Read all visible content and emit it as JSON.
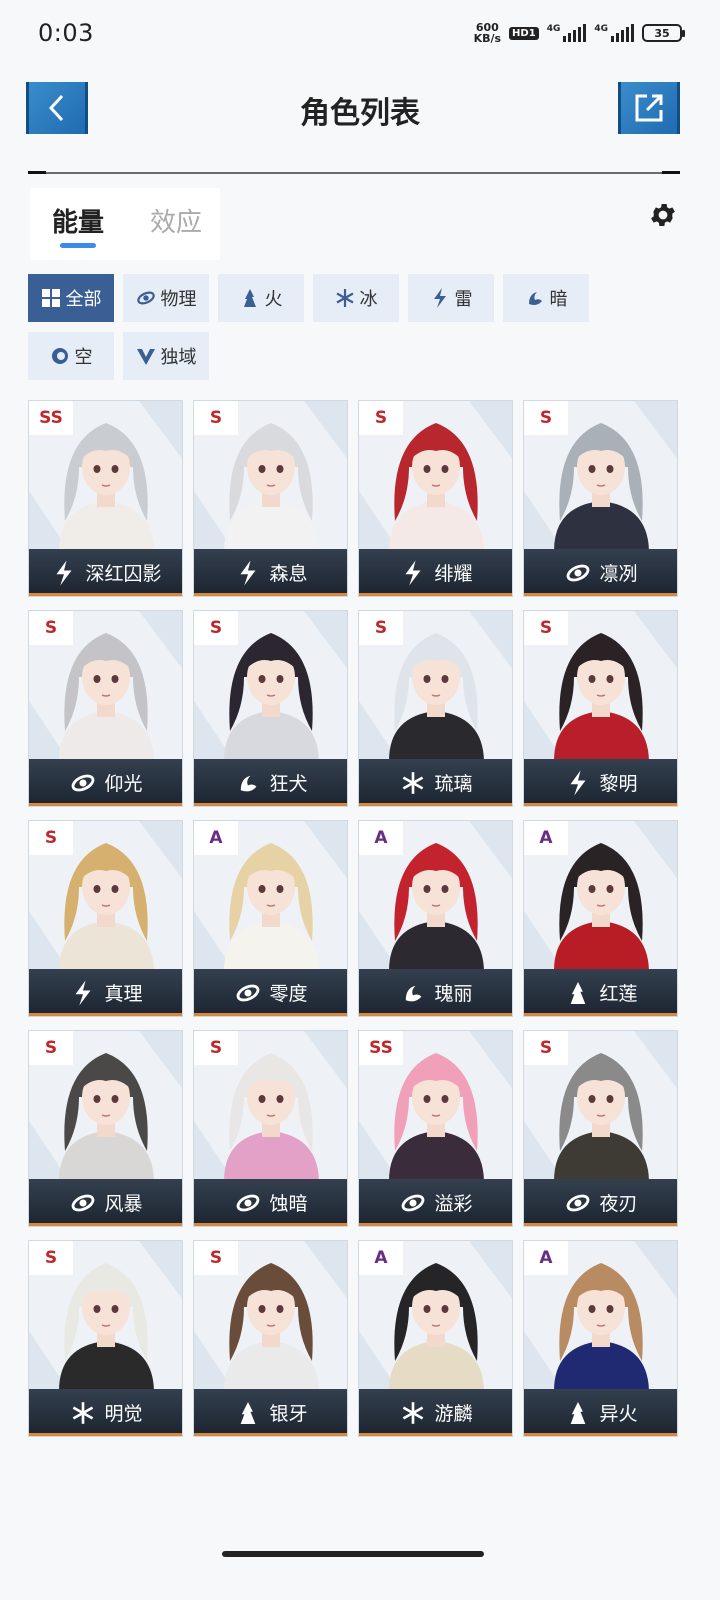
{
  "status_bar": {
    "time": "0:03",
    "net_speed_value": "600",
    "net_speed_unit": "KB/s",
    "hd_label": "HD1",
    "signal1_label": "4G",
    "signal2_label": "4G",
    "battery": "35"
  },
  "header": {
    "title": "角色列表",
    "back_icon": "chevron-left-icon",
    "share_icon": "external-link-icon",
    "button_color": "#2a7ac0"
  },
  "tabs": [
    {
      "label": "能量",
      "active": true
    },
    {
      "label": "效应",
      "active": false
    }
  ],
  "settings_icon": "gear-icon",
  "filters": [
    {
      "label": "全部",
      "icon": "grid-icon",
      "active": true
    },
    {
      "label": "物理",
      "icon": "physical-icon",
      "active": false
    },
    {
      "label": "火",
      "icon": "fire-icon",
      "active": false
    },
    {
      "label": "冰",
      "icon": "snowflake-icon",
      "active": false
    },
    {
      "label": "雷",
      "icon": "lightning-icon",
      "active": false
    },
    {
      "label": "暗",
      "icon": "dark-icon",
      "active": false
    },
    {
      "label": "空",
      "icon": "void-icon",
      "active": false
    },
    {
      "label": "独域",
      "icon": "domain-icon",
      "active": false
    }
  ],
  "characters": [
    {
      "rank": "SS",
      "name": "深红囚影",
      "element": "lightning-icon"
    },
    {
      "rank": "S",
      "name": "森息",
      "element": "lightning-icon"
    },
    {
      "rank": "S",
      "name": "绯耀",
      "element": "lightning-icon"
    },
    {
      "rank": "S",
      "name": "凛冽",
      "element": "physical-icon"
    },
    {
      "rank": "S",
      "name": "仰光",
      "element": "physical-icon"
    },
    {
      "rank": "S",
      "name": "狂犬",
      "element": "dark-icon"
    },
    {
      "rank": "S",
      "name": "琉璃",
      "element": "snowflake-icon"
    },
    {
      "rank": "S",
      "name": "黎明",
      "element": "lightning-icon"
    },
    {
      "rank": "S",
      "name": "真理",
      "element": "lightning-icon"
    },
    {
      "rank": "A",
      "name": "零度",
      "element": "physical-icon"
    },
    {
      "rank": "A",
      "name": "瑰丽",
      "element": "dark-icon"
    },
    {
      "rank": "A",
      "name": "红莲",
      "element": "fire-icon"
    },
    {
      "rank": "S",
      "name": "风暴",
      "element": "physical-icon"
    },
    {
      "rank": "S",
      "name": "蚀暗",
      "element": "physical-icon"
    },
    {
      "rank": "SS",
      "name": "溢彩",
      "element": "physical-icon"
    },
    {
      "rank": "S",
      "name": "夜刃",
      "element": "physical-icon"
    },
    {
      "rank": "S",
      "name": "明觉",
      "element": "snowflake-icon"
    },
    {
      "rank": "S",
      "name": "银牙",
      "element": "fire-icon"
    },
    {
      "rank": "A",
      "name": "游麟",
      "element": "snowflake-icon"
    },
    {
      "rank": "A",
      "name": "异火",
      "element": "fire-icon"
    }
  ],
  "colors": {
    "accent_blue": "#3d8ae8",
    "filter_active": "#3a5f94",
    "filter_inactive": "#e6edf6",
    "rank_red": "#c0262a",
    "rank_purple": "#6a2d86",
    "card_bar": "#1c2430",
    "card_bar_accent": "#d5883e"
  }
}
